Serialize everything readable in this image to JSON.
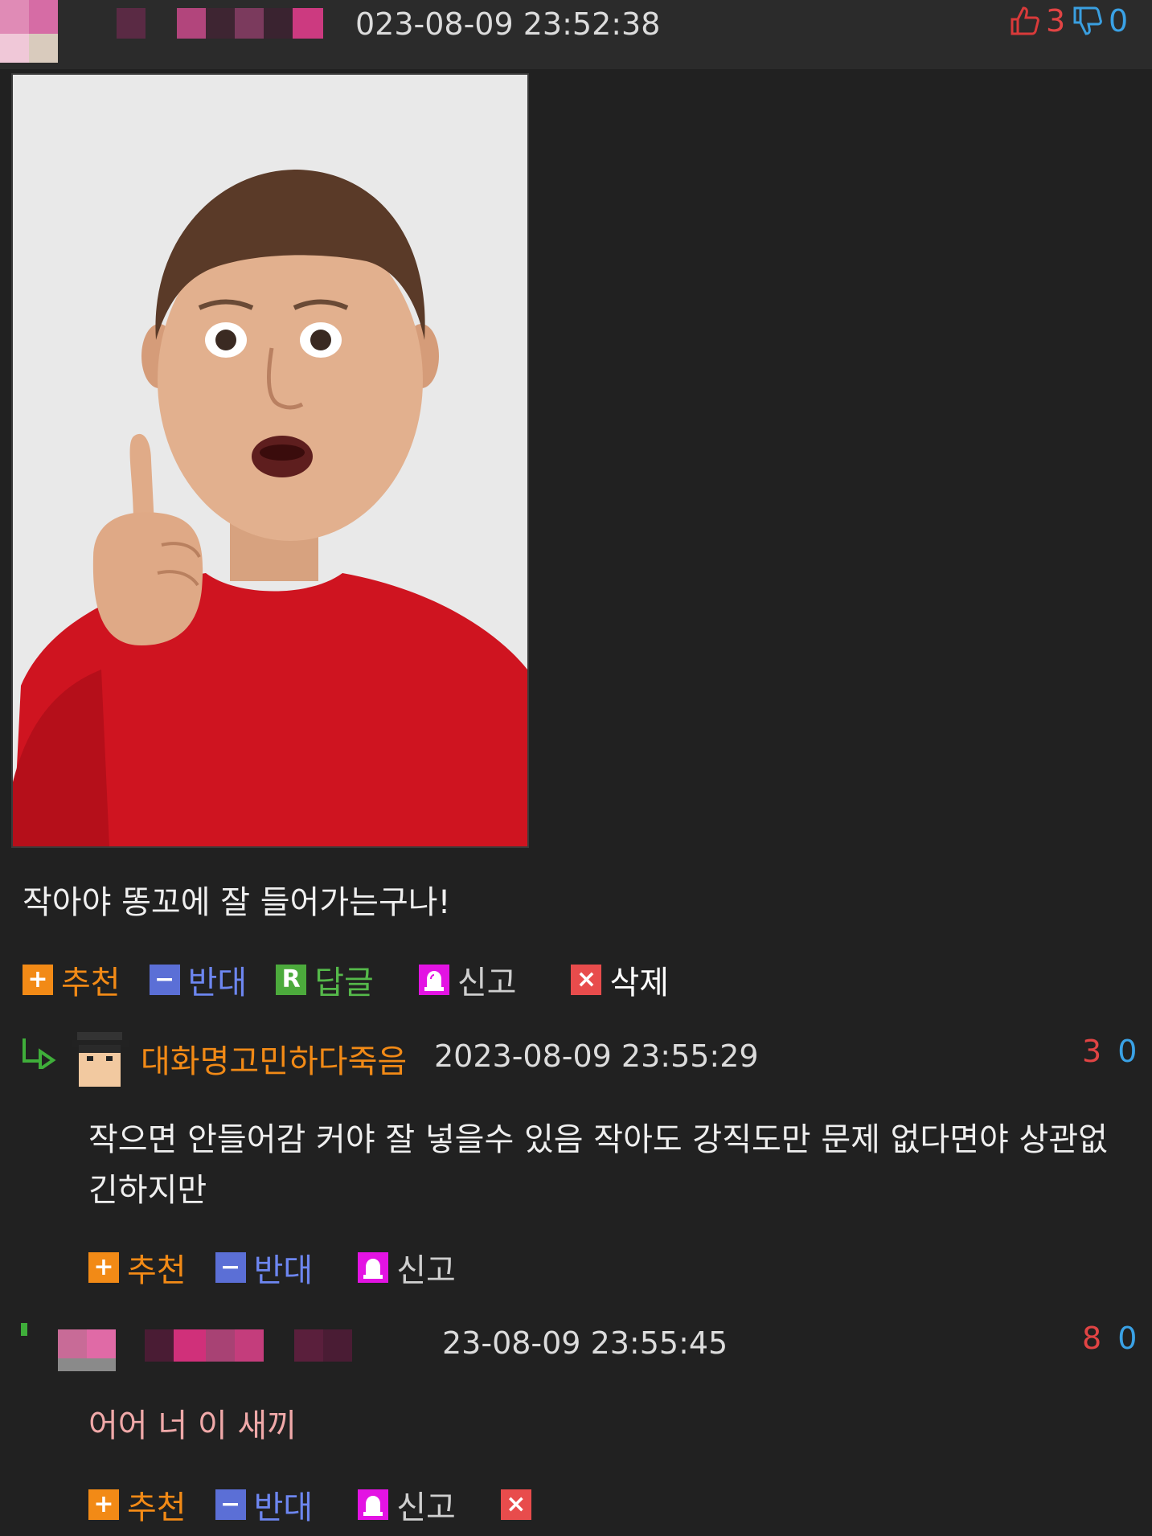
{
  "main_comment": {
    "timestamp_visible": "023-08-09 23:52:38",
    "upvotes": "3",
    "downvotes": "0",
    "text": "작아야 똥꼬에 잘 들어가는구나!",
    "actions": {
      "recommend": "추천",
      "oppose": "반대",
      "reply": "답글",
      "report": "신고",
      "delete": "삭제"
    }
  },
  "reply1": {
    "nickname": "대화명고민하다죽음",
    "timestamp": "2023-08-09 23:55:29",
    "upvotes": "3",
    "downvotes": "0",
    "text": "작으면 안들어감 커야 잘 넣을수 있음 작아도 강직도만 문제 없다면야 상관없 긴하지만",
    "actions": {
      "recommend": "추천",
      "oppose": "반대",
      "report": "신고"
    }
  },
  "reply2": {
    "timestamp_visible": "23-08-09 23:55:45",
    "upvotes": "8",
    "downvotes": "0",
    "text": "어어 너 이 새끼",
    "actions": {
      "recommend": "추천",
      "oppose": "반대",
      "report": "신고"
    }
  },
  "colors": {
    "background": "#212121",
    "header": "#2b2b2b",
    "accent_orange": "#f28a16",
    "oppose_blue": "#5b6fd6",
    "reply_green": "#4caa3c",
    "report_magenta": "#e313e3",
    "delete_red": "#e84c4c",
    "upvote_red": "#e14444",
    "downvote_blue": "#3aa2e6"
  },
  "icons": [
    "thumbs-up-icon",
    "thumbs-down-icon",
    "plus-icon",
    "minus-icon",
    "reply-r-icon",
    "siren-icon",
    "close-icon",
    "reply-arrow-icon",
    "avatar"
  ]
}
